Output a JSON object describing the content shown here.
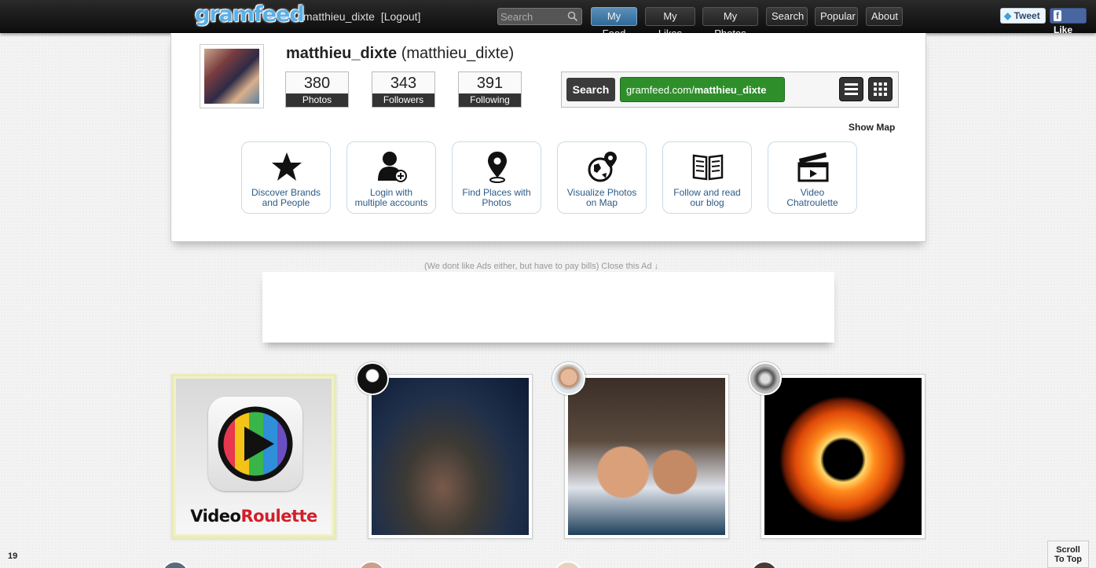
{
  "header": {
    "logo": "gramfeed",
    "separator": "/",
    "username": "matthieu_dixte",
    "logout_label": "[Logout]",
    "search_placeholder": "Search",
    "nav": [
      "My Feed",
      "My Likes",
      "My Photos",
      "Search",
      "Popular",
      "About"
    ],
    "active_nav": "My Feed",
    "tweet_label": "Tweet",
    "like_label": "Like"
  },
  "profile": {
    "username": "matthieu_dixte",
    "fullname": "(matthieu_dixte)",
    "stats": [
      {
        "value": "380",
        "label": "Photos"
      },
      {
        "value": "343",
        "label": "Followers"
      },
      {
        "value": "391",
        "label": "Following"
      }
    ],
    "search_button": "Search",
    "url_prefix": "gramfeed.com/",
    "url_user": "matthieu_dixte",
    "show_map": "Show Map"
  },
  "tiles": [
    {
      "icon": "star-icon",
      "line1": "Discover Brands",
      "line2": "and People"
    },
    {
      "icon": "add-user-icon",
      "line1": "Login with",
      "line2": "multiple accounts"
    },
    {
      "icon": "map-pin-icon",
      "line1": "Find Places with",
      "line2": "Photos"
    },
    {
      "icon": "globe-pin-icon",
      "line1": "Visualize Photos",
      "line2": "on Map"
    },
    {
      "icon": "open-book-icon",
      "line1": "Follow and read",
      "line2": "our blog"
    },
    {
      "icon": "clapperboard-icon",
      "line1": "Video",
      "line2": "Chatroulette"
    }
  ],
  "ad": {
    "note": "(We dont like Ads either, but have to pay bills) Close this Ad ↓"
  },
  "promo": {
    "text_dark": "Video",
    "text_red": "Roulette"
  },
  "footer": {
    "page_count": "19",
    "scroll_top_line1": "Scroll",
    "scroll_top_line2": "To Top"
  },
  "colors": {
    "accent_blue": "#2f6a99",
    "url_green": "#2e8f2a",
    "link_blue": "#2b5b86",
    "promo_red": "#d21f2a"
  }
}
